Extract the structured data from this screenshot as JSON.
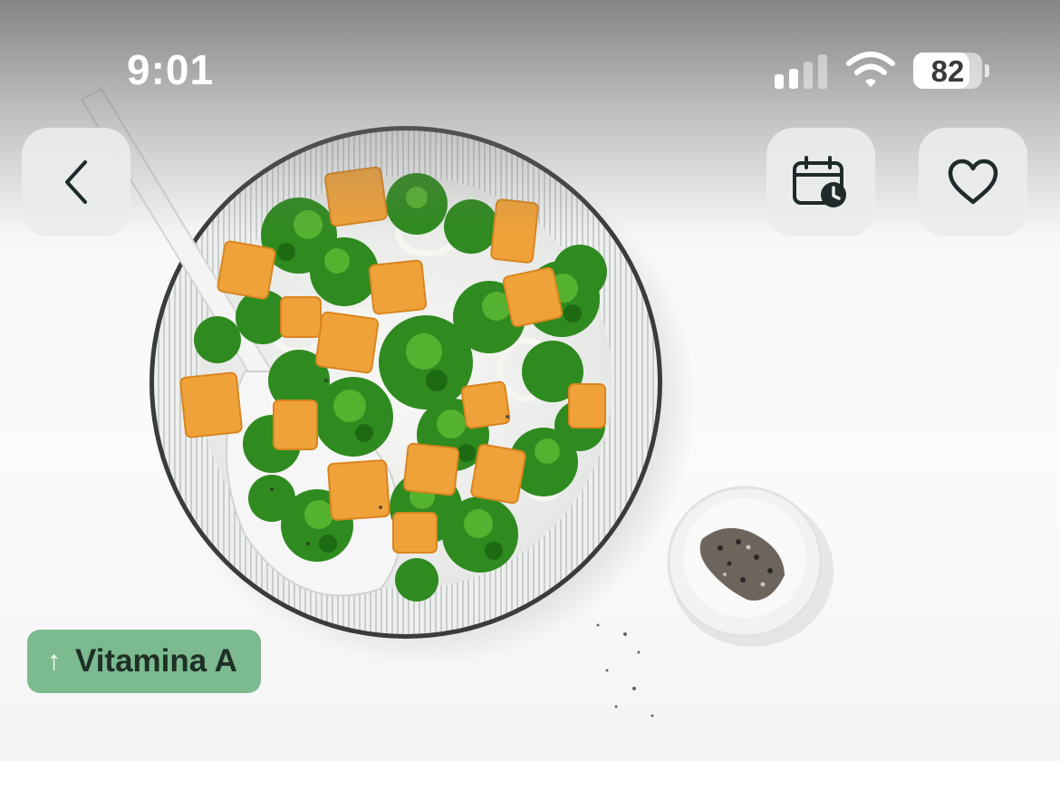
{
  "status_bar": {
    "time": "9:01",
    "battery_percent": "82",
    "battery_level": 0.82,
    "signal_bars_active": 2,
    "signal_bars_total": 4
  },
  "nav": {
    "back_icon": "chevron-left-icon",
    "schedule_icon": "calendar-clock-icon",
    "favorite_icon": "heart-outline-icon"
  },
  "hero": {
    "photo": "broccoli-and-butternut-squash-salad-bowl"
  },
  "nutrient_tag": {
    "arrow": "↑",
    "label": "Vitamina A",
    "color": "#7cba8f"
  },
  "colors": {
    "accent_green": "#7cba8f",
    "icon_dark": "#1f2a2a",
    "button_bg": "#eaecec"
  }
}
